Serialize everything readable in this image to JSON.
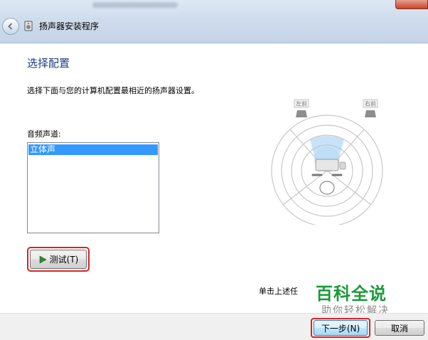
{
  "window": {
    "title": "扬声器安装程序"
  },
  "page": {
    "heading": "选择配置",
    "description": "选择下面与您的计算机配置最相近的扬声器设置。",
    "list_label": "音频声道:",
    "channels": [
      "立体声"
    ],
    "test_button": "测试(T)",
    "footer_text": "单击上述任"
  },
  "diagram": {
    "speaker_left": "左前",
    "speaker_right": "右前"
  },
  "buttons": {
    "next": "下一步(N)",
    "cancel": "取消"
  },
  "watermark": {
    "title": "百科全说",
    "subtitle": "助你轻松解决"
  },
  "colors": {
    "heading": "#1f3c88",
    "selection": "#3399ff",
    "highlight": "#d4242b",
    "watermark": "#1a9b3a"
  }
}
